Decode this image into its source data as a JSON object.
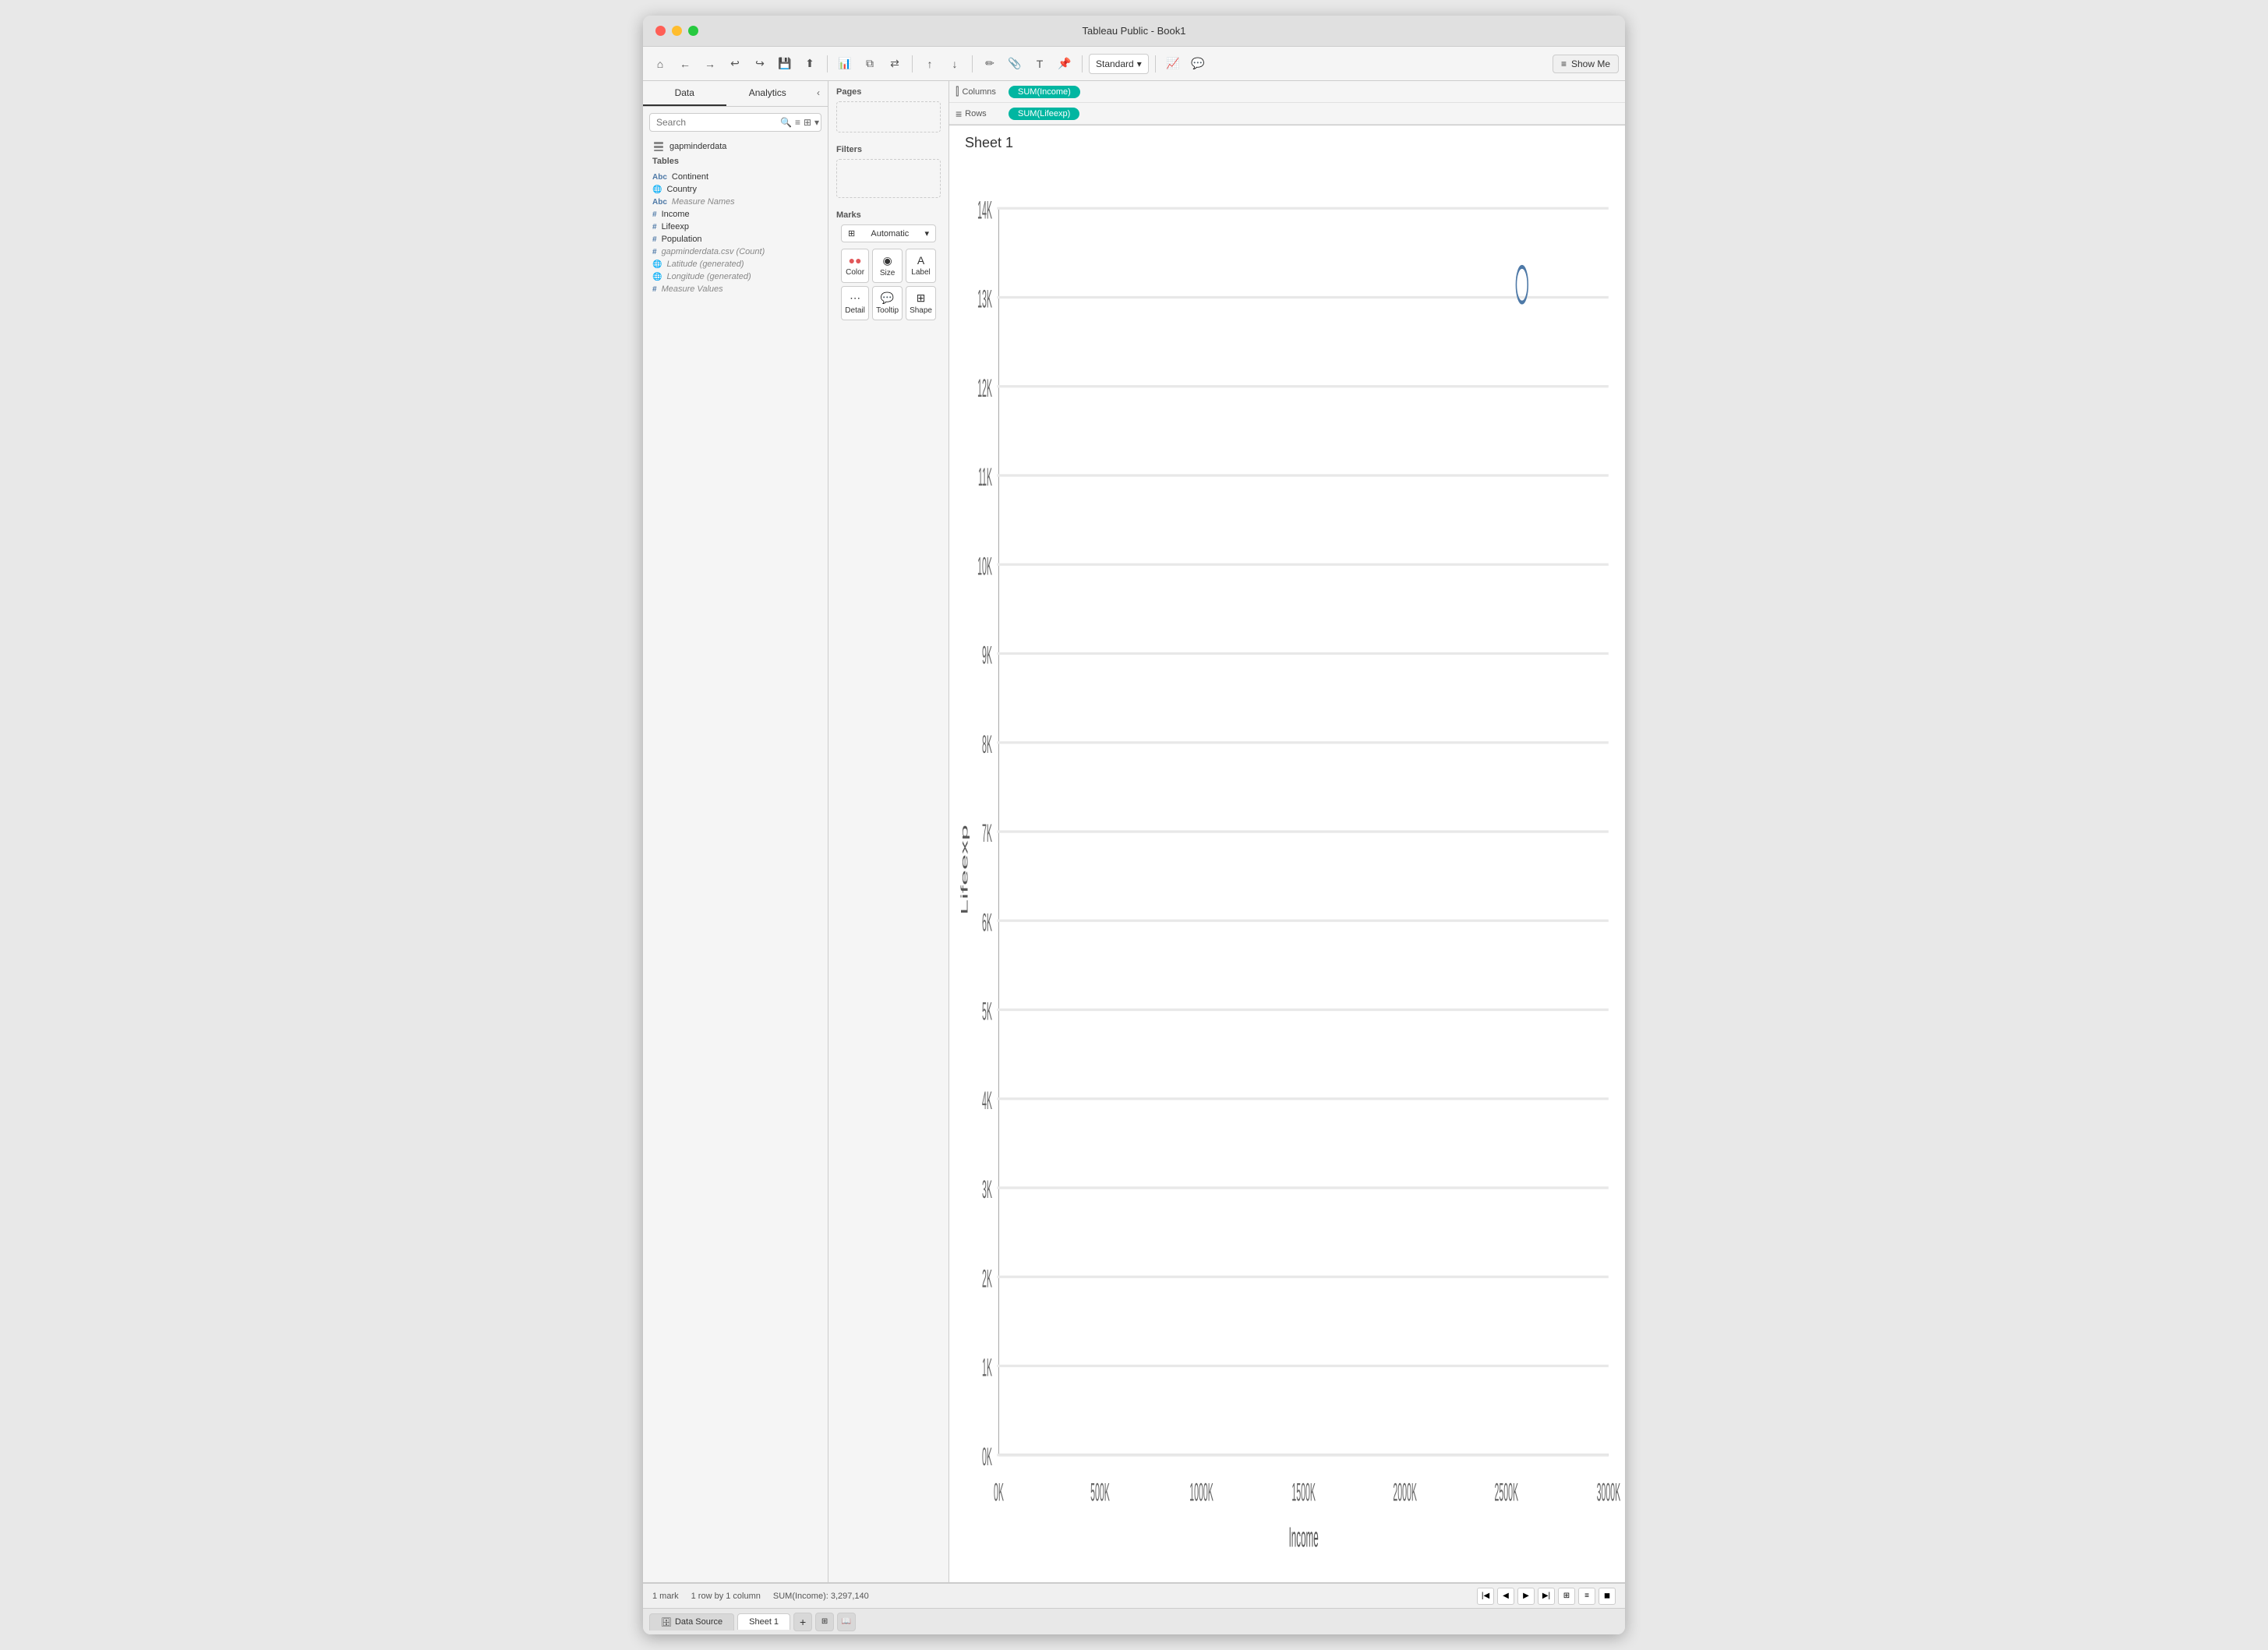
{
  "window": {
    "title": "Tableau Public - Book1"
  },
  "titlebar": {
    "title": "Tableau Public - Book1"
  },
  "toolbar": {
    "standard_label": "Standard",
    "show_me_label": "Show Me",
    "show_me_icon": "≡"
  },
  "left_panel": {
    "tab_data": "Data",
    "tab_analytics": "Analytics",
    "search_placeholder": "Search",
    "datasource": {
      "name": "gapminderdata",
      "icon": "db"
    },
    "tables_label": "Tables",
    "fields": [
      {
        "name": "Continent",
        "type": "abc",
        "category": "dimension"
      },
      {
        "name": "Country",
        "type": "globe",
        "category": "dimension"
      },
      {
        "name": "Measure Names",
        "type": "abc",
        "category": "dimension",
        "italic": true
      },
      {
        "name": "Income",
        "type": "hash",
        "category": "measure"
      },
      {
        "name": "Lifeexp",
        "type": "hash",
        "category": "measure"
      },
      {
        "name": "Population",
        "type": "hash",
        "category": "measure"
      },
      {
        "name": "gapminderdata.csv (Count)",
        "type": "hash",
        "category": "measure"
      },
      {
        "name": "Latitude (generated)",
        "type": "globe-hash",
        "category": "measure"
      },
      {
        "name": "Longitude (generated)",
        "type": "globe-hash",
        "category": "measure"
      },
      {
        "name": "Measure Values",
        "type": "hash",
        "category": "measure"
      }
    ]
  },
  "pages_label": "Pages",
  "filters_label": "Filters",
  "marks_label": "Marks",
  "marks": {
    "type": "Automatic",
    "buttons": [
      {
        "label": "Color",
        "icon": "⬤⬤"
      },
      {
        "label": "Size",
        "icon": "◉"
      },
      {
        "label": "Label",
        "icon": "A"
      },
      {
        "label": "Detail",
        "icon": "⋯"
      },
      {
        "label": "Tooltip",
        "icon": "💬"
      },
      {
        "label": "Shape",
        "icon": "⊞"
      }
    ]
  },
  "shelf": {
    "columns_label": "Columns",
    "rows_label": "Rows",
    "columns_pill": "SUM(Income)",
    "rows_pill": "SUM(Lifeexp)"
  },
  "chart": {
    "title": "Sheet 1",
    "x_axis_label": "Income",
    "y_axis_label": "Lifeexp",
    "x_ticks": [
      "0K",
      "500K",
      "1000K",
      "1500K",
      "2000K",
      "2500K",
      "3000K"
    ],
    "y_ticks": [
      "0K",
      "1K",
      "2K",
      "3K",
      "4K",
      "5K",
      "6K",
      "7K",
      "8K",
      "9K",
      "10K",
      "11K",
      "12K",
      "13K",
      "14K"
    ],
    "dot": {
      "cx_pct": 87,
      "cy_pct": 8
    }
  },
  "bottom_tabs": {
    "data_source": "Data Source",
    "sheet1": "Sheet 1"
  },
  "status_bar": {
    "marks": "1 mark",
    "rows": "1 row by 1 column",
    "sum": "SUM(Income): 3,297,140"
  }
}
